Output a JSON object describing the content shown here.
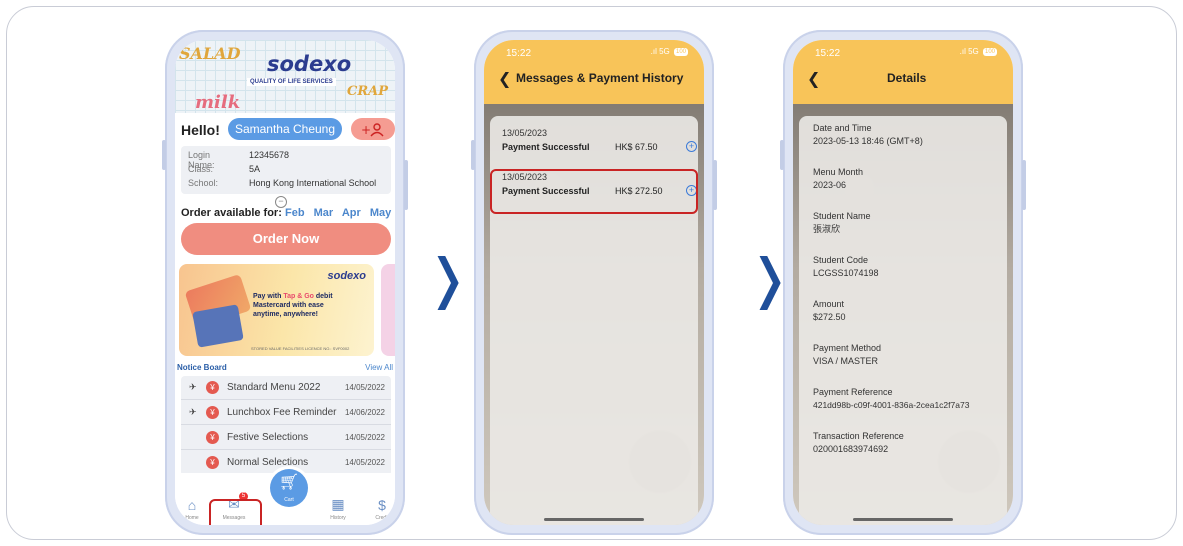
{
  "phone1": {
    "banner": {
      "doodles": [
        "SALAD",
        "CRAP",
        "milk"
      ],
      "logo": "sodexo",
      "logo_sub": "QUALITY OF LIFE SERVICES"
    },
    "greeting": "Hello!",
    "user_name": "Samantha Cheung",
    "add_user_label": "+ ♂",
    "info": [
      {
        "key": "Login Name:",
        "value": "12345678"
      },
      {
        "key": "Class:",
        "value": "5A"
      },
      {
        "key": "School:",
        "value": "Hong Kong International School"
      }
    ],
    "order_label": "Order available for:",
    "months": "Feb Mar Apr May",
    "order_button": "Order Now",
    "ad": {
      "logo": "sodexo",
      "line1_a": "Pay with ",
      "line1_hl": "Tap & Go",
      "line1_b": " debit",
      "line2": "Mastercard with ease",
      "line3": "anytime, anywhere!",
      "footer": "STORED VALUE FACILITIES LICENCE NO.: SVF0002"
    },
    "notice_title": "Notice Board",
    "view_all": "View All",
    "notices": [
      {
        "title": "Standard Menu 2022",
        "date": "14/05/2022",
        "pinned": true
      },
      {
        "title": "Lunchbox Fee Reminder",
        "date": "14/06/2022",
        "pinned": true
      },
      {
        "title": "Festive Selections",
        "date": "14/05/2022",
        "pinned": false
      },
      {
        "title": "Normal Selections",
        "date": "14/05/2022",
        "pinned": false
      }
    ],
    "tabs": {
      "home": "Home",
      "messages": "Messages",
      "messages_badge": "5",
      "cart": "Cart",
      "history": "History",
      "credit": "Credit"
    }
  },
  "phone2": {
    "time": "15:22",
    "signal": "5G",
    "battery": "100",
    "title": "Messages & Payment History",
    "payments": [
      {
        "date": "13/05/2023",
        "status": "Payment Successful",
        "amount": "HK$ 67.50"
      },
      {
        "date": "13/05/2023",
        "status": "Payment Successful",
        "amount": "HK$ 272.50"
      }
    ]
  },
  "phone3": {
    "time": "15:22",
    "signal": "5G",
    "battery": "100",
    "title": "Details",
    "fields": [
      {
        "label": "Date and Time",
        "value": "2023-05-13 18:46 (GMT+8)"
      },
      {
        "label": "Menu Month",
        "value": "2023-06"
      },
      {
        "label": "Student Name",
        "value": "張淑欣"
      },
      {
        "label": "Student Code",
        "value": "LCGSS1074198"
      },
      {
        "label": "Amount",
        "value": "$272.50"
      },
      {
        "label": "Payment Method",
        "value": "VISA / MASTER"
      },
      {
        "label": "Payment Reference",
        "value": "421dd98b-c09f-4001-836a-2cea1c2f7a73"
      },
      {
        "label": "Transaction Reference",
        "value": "020001683974692"
      }
    ]
  },
  "arrows": [
    "❭",
    "❭"
  ],
  "colors": {
    "accent_yellow": "#f8c459",
    "accent_blue": "#5b9be4",
    "order_button": "#f08d80",
    "highlight_red": "#c92424",
    "arrow_blue": "#1f4f9a"
  }
}
